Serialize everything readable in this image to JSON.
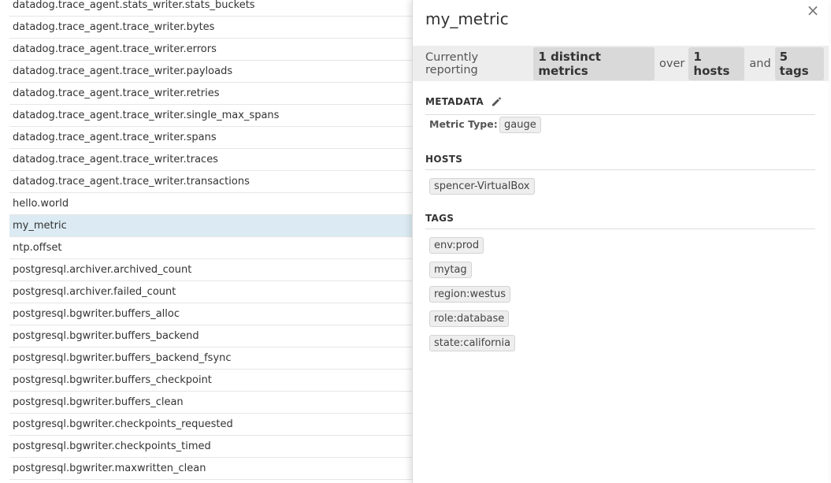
{
  "metric_list": [
    "datadog.trace_agent.stats_writer.stats_buckets",
    "datadog.trace_agent.trace_writer.bytes",
    "datadog.trace_agent.trace_writer.errors",
    "datadog.trace_agent.trace_writer.payloads",
    "datadog.trace_agent.trace_writer.retries",
    "datadog.trace_agent.trace_writer.single_max_spans",
    "datadog.trace_agent.trace_writer.spans",
    "datadog.trace_agent.trace_writer.traces",
    "datadog.trace_agent.trace_writer.transactions",
    "hello.world",
    "my_metric",
    "ntp.offset",
    "postgresql.archiver.archived_count",
    "postgresql.archiver.failed_count",
    "postgresql.bgwriter.buffers_alloc",
    "postgresql.bgwriter.buffers_backend",
    "postgresql.bgwriter.buffers_backend_fsync",
    "postgresql.bgwriter.buffers_checkpoint",
    "postgresql.bgwriter.buffers_clean",
    "postgresql.bgwriter.checkpoints_requested",
    "postgresql.bgwriter.checkpoints_timed",
    "postgresql.bgwriter.maxwritten_clean"
  ],
  "selected_metric": "my_metric",
  "panel": {
    "close_icon": "×",
    "title": "my_metric",
    "reporting": {
      "prefix": "Currently reporting",
      "metrics": "1 distinct metrics",
      "over": "over",
      "hosts": "1 hosts",
      "and": "and",
      "tags": "5 tags"
    },
    "metadata": {
      "heading": "METADATA",
      "icon": "pencil-icon",
      "metric_type_label": "Metric Type:",
      "metric_type_value": "gauge"
    },
    "hosts": {
      "heading": "HOSTS",
      "items": [
        "spencer-VirtualBox"
      ]
    },
    "tags": {
      "heading": "TAGS",
      "items": [
        "env:prod",
        "mytag",
        "region:westus",
        "role:database",
        "state:california"
      ]
    }
  },
  "colors": {
    "selected_row": "#dcebf3",
    "reporting_bar": "#ededed",
    "pill": "#d9d9d9"
  }
}
